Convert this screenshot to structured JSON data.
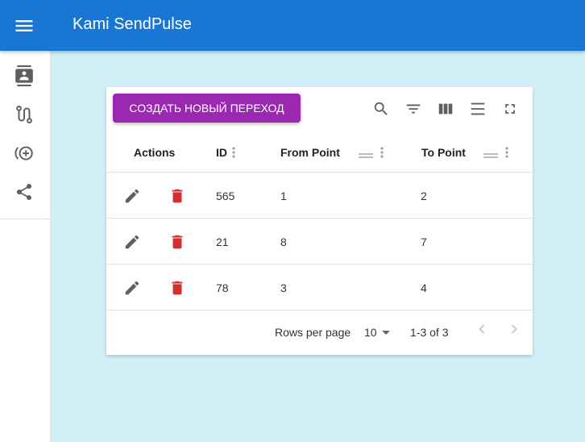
{
  "app": {
    "title": "Kami SendPulse"
  },
  "icons": {
    "menu": "menu-icon",
    "sidebar": [
      "contacts-icon",
      "route-icon",
      "add-circle-icon",
      "share-icon"
    ],
    "toolbar": [
      "search-icon",
      "filter-icon",
      "columns-icon",
      "density-icon",
      "fullscreen-icon"
    ],
    "row_actions": [
      "edit-icon",
      "delete-icon"
    ],
    "pagination": [
      "chevron-left-icon",
      "chevron-right-icon"
    ]
  },
  "colors": {
    "appbar": "#1976d2",
    "page_background": "#d2eff7",
    "create_button": "#9c27b0",
    "delete_icon": "#d32f2f",
    "icon_gray": "#616161"
  },
  "toolbar": {
    "create_label": "СОЗДАТЬ НОВЫЙ ПЕРЕХОД"
  },
  "table": {
    "columns": [
      "Actions",
      "ID",
      "From Point",
      "To Point"
    ],
    "rows": [
      {
        "id": "565",
        "from": "1",
        "to": "2"
      },
      {
        "id": "21",
        "from": "8",
        "to": "7"
      },
      {
        "id": "78",
        "from": "3",
        "to": "4"
      }
    ]
  },
  "pagination": {
    "rows_per_page_label": "Rows per page",
    "rows_per_page": "10",
    "range": "1-3 of 3"
  }
}
